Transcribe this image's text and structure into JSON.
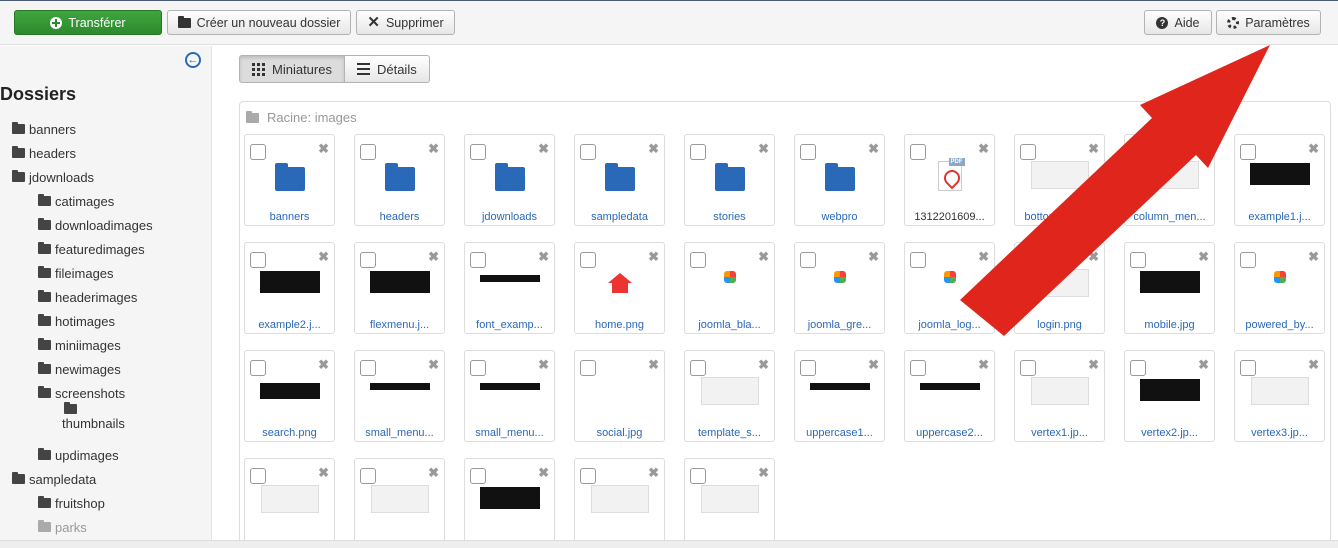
{
  "toolbar": {
    "upload_label": "Transférer",
    "new_folder_label": "Créer un nouveau dossier",
    "delete_label": "Supprimer",
    "help_label": "Aide",
    "options_label": "Paramètres"
  },
  "sidebar": {
    "title": "Dossiers",
    "items": [
      {
        "label": "banners"
      },
      {
        "label": "headers"
      },
      {
        "label": "jdownloads"
      },
      {
        "label": "catimages"
      },
      {
        "label": "downloadimages"
      },
      {
        "label": "featuredimages"
      },
      {
        "label": "fileimages"
      },
      {
        "label": "headerimages"
      },
      {
        "label": "hotimages"
      },
      {
        "label": "miniimages"
      },
      {
        "label": "newimages"
      },
      {
        "label": "screenshots"
      },
      {
        "label": "thumbnails"
      },
      {
        "label": "updimages"
      },
      {
        "label": "sampledata"
      },
      {
        "label": "fruitshop"
      },
      {
        "label": "parks"
      }
    ]
  },
  "view": {
    "thumbnails_label": "Miniatures",
    "details_label": "Détails"
  },
  "browser": {
    "root_label": "Racine: images",
    "tiles": [
      {
        "label": "banners",
        "kind": "folder"
      },
      {
        "label": "headers",
        "kind": "folder"
      },
      {
        "label": "jdownloads",
        "kind": "folder"
      },
      {
        "label": "sampledata",
        "kind": "folder"
      },
      {
        "label": "stories",
        "kind": "folder"
      },
      {
        "label": "webpro",
        "kind": "folder"
      },
      {
        "label": "1312201609...",
        "kind": "pdf"
      },
      {
        "label": "bottom_men...",
        "kind": "shot"
      },
      {
        "label": "column_men...",
        "kind": "shot"
      },
      {
        "label": "example1.j...",
        "kind": "dark"
      },
      {
        "label": "example2.j...",
        "kind": "dark"
      },
      {
        "label": "flexmenu.j...",
        "kind": "dark"
      },
      {
        "label": "font_examp...",
        "kind": "strip"
      },
      {
        "label": "home.png",
        "kind": "house"
      },
      {
        "label": "joomla_bla...",
        "kind": "joomla"
      },
      {
        "label": "joomla_gre...",
        "kind": "joomla"
      },
      {
        "label": "joomla_log...",
        "kind": "joomla"
      },
      {
        "label": "login.png",
        "kind": "shot"
      },
      {
        "label": "mobile.jpg",
        "kind": "dark"
      },
      {
        "label": "powered_by...",
        "kind": "joomla"
      },
      {
        "label": "search.png",
        "kind": "strip"
      },
      {
        "label": "small_menu...",
        "kind": "strip"
      },
      {
        "label": "small_menu...",
        "kind": "strip"
      },
      {
        "label": "social.jpg",
        "kind": "blank"
      },
      {
        "label": "template_s...",
        "kind": "shot"
      },
      {
        "label": "uppercase1...",
        "kind": "strip"
      },
      {
        "label": "uppercase2...",
        "kind": "strip"
      },
      {
        "label": "vertex1.jp...",
        "kind": "shot"
      },
      {
        "label": "vertex2.jp...",
        "kind": "dark"
      },
      {
        "label": "vertex3.jp...",
        "kind": "shot"
      },
      {
        "label": "",
        "kind": "shot"
      },
      {
        "label": "",
        "kind": "shot"
      },
      {
        "label": "",
        "kind": "dark"
      },
      {
        "label": "",
        "kind": "shot"
      },
      {
        "label": "",
        "kind": "shot"
      }
    ]
  },
  "colors": {
    "accent": "#2a69b8",
    "upload_button": "#3fa53f",
    "annotation_arrow": "#e0261c"
  }
}
